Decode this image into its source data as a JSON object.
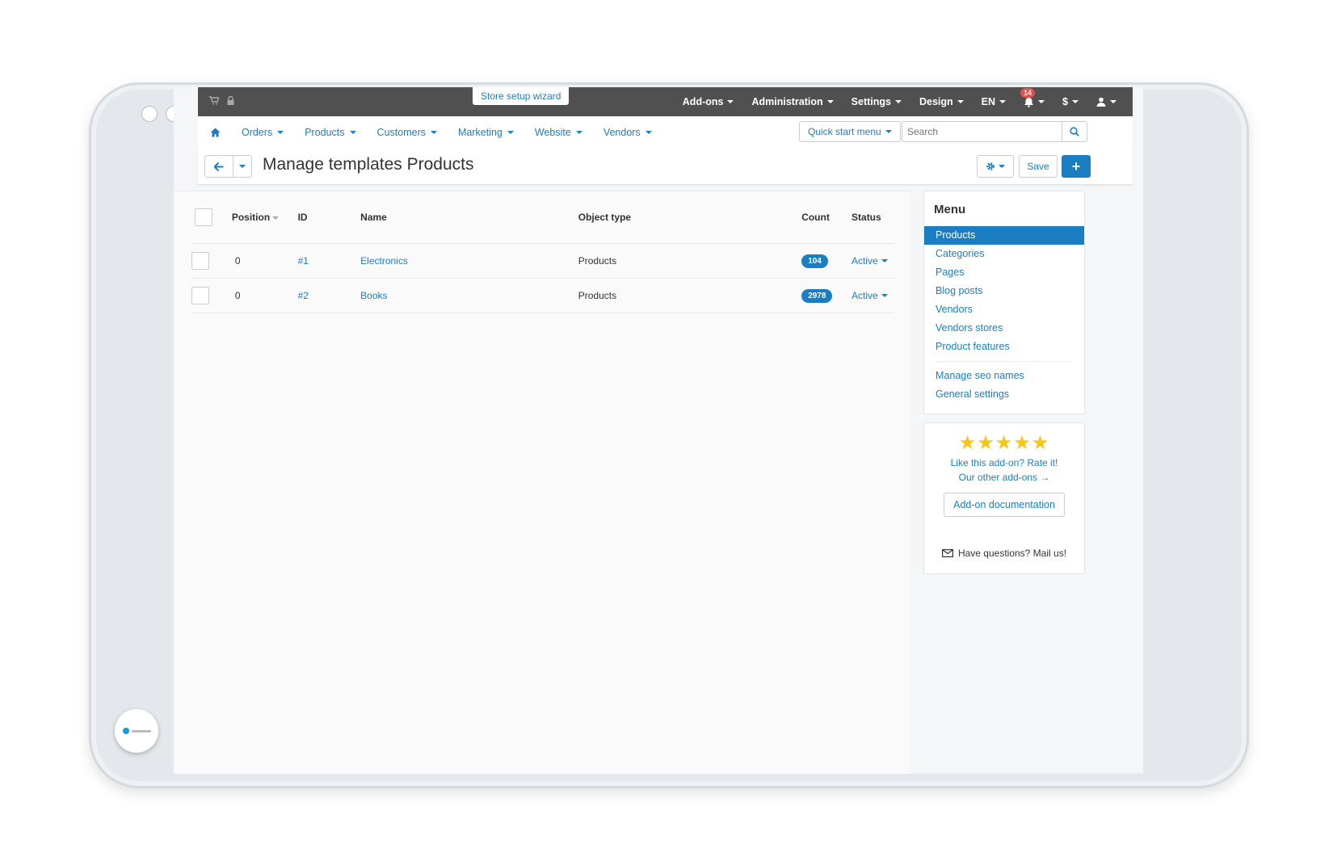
{
  "topbar": {
    "wizard": "Store setup wizard",
    "menu": [
      "Add-ons",
      "Administration",
      "Settings",
      "Design",
      "EN"
    ],
    "notifications": "14",
    "currency": "$"
  },
  "nav": {
    "items": [
      "Orders",
      "Products",
      "Customers",
      "Marketing",
      "Website",
      "Vendors"
    ],
    "quick_start": "Quick start menu",
    "search_placeholder": "Search"
  },
  "title": {
    "text": "Manage templates Products",
    "save": "Save",
    "add": "+"
  },
  "table": {
    "headers": [
      "Position",
      "ID",
      "Name",
      "Object type",
      "Count",
      "Status"
    ],
    "rows": [
      {
        "position": "0",
        "id": "#1",
        "name": "Electronics",
        "object_type": "Products",
        "count": "104",
        "status": "Active"
      },
      {
        "position": "0",
        "id": "#2",
        "name": "Books",
        "object_type": "Products",
        "count": "2978",
        "status": "Active"
      }
    ]
  },
  "sidebar": {
    "title": "Menu",
    "items": [
      "Products",
      "Categories",
      "Pages",
      "Blog posts",
      "Vendors",
      "Vendors stores",
      "Product features"
    ],
    "extra_items": [
      "Manage seo names",
      "General settings"
    ],
    "active_index": 0
  },
  "rate": {
    "stars": "★★★★★",
    "rating": 5,
    "rate_text": "Like this add-on? Rate it!",
    "other": "Our other add-ons →",
    "doc_button": "Add-on documentation",
    "mail_text": "Have questions? Mail us!"
  },
  "colors": {
    "accent": "#1b7ec2",
    "topbar": "#505050",
    "star": "#f5c518",
    "badge_red": "#d9534f"
  }
}
